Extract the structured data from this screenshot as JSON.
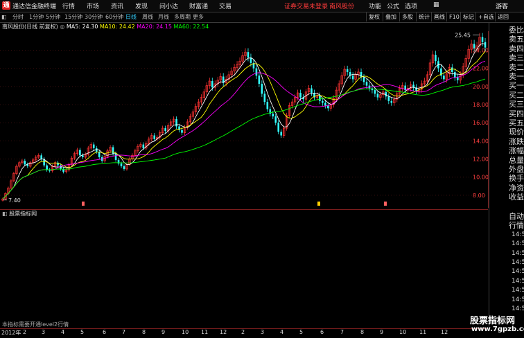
{
  "app": {
    "title": "通达信金融终端",
    "logo_char": "通",
    "user_label": "游客"
  },
  "menu": [
    "行情",
    "市场",
    "资讯",
    "发现",
    "问小达",
    "财富通",
    "交易"
  ],
  "status": {
    "warning": "证券交易未登录",
    "stock_name": "南风股份"
  },
  "periods": [
    "分时",
    "1分钟",
    "5分钟",
    "15分钟",
    "30分钟",
    "60分钟",
    "日线",
    "周线",
    "月线",
    "多周期",
    "更多"
  ],
  "active_period": "日线",
  "toolbar_buttons": [
    "复权",
    "叠加",
    "多股",
    "统计",
    "画线",
    "F10",
    "标记",
    "+自选",
    "返回"
  ],
  "indicator": {
    "stock_label": "南风股份(日线 前复权)",
    "ma5": "MA5: 24.30",
    "ma10": "MA10: 24.42",
    "ma20": "MA20: 24.15",
    "ma60": "MA60: 22.54"
  },
  "price_axis": [
    "24.00",
    "22.00",
    "20.00",
    "18.00",
    "16.00",
    "14.00",
    "12.00",
    "10.00",
    "8.00"
  ],
  "annotations": {
    "high": "25.45",
    "low": "7.40"
  },
  "right_panel": [
    "委比",
    "卖五",
    "卖四",
    "卖三",
    "卖二",
    "卖一",
    "买一",
    "买二",
    "买三",
    "买四",
    "买五",
    "现价",
    "涨跌",
    "涨幅",
    "总量",
    "外盘",
    "换手",
    "净资",
    "收益",
    "自动",
    "行情",
    "14:5",
    "14:5",
    "14:5",
    "14:5",
    "14:5",
    "14:5",
    "14:5",
    "14:5",
    "14:5"
  ],
  "sub_chart": {
    "title": "股票指标网",
    "message": "本指标需要开通level2行情"
  },
  "time_axis": [
    "2012年",
    "2",
    "3",
    "4",
    "5",
    "6",
    "7",
    "8",
    "9",
    "10",
    "11",
    "12",
    "2",
    "3",
    "4",
    "5",
    "6",
    "7",
    "8",
    "9",
    "10",
    "11",
    "12"
  ],
  "watermark": {
    "line1": "股票指标网",
    "line2": "www.7gpzb.com"
  },
  "colors": {
    "ma5": "#ffffff",
    "ma10": "#ffff00",
    "ma20": "#ff00ff",
    "ma60": "#00ff00",
    "up": "#ff3333",
    "down": "#33ffff",
    "accent": "#35d1ff"
  },
  "chart_data": {
    "type": "candlestick",
    "y_range": [
      7,
      25.8
    ],
    "closes": [
      7.6,
      8.2,
      8.8,
      9.6,
      10.4,
      11.2,
      11.6,
      11.8,
      11.4,
      11.2,
      11.6,
      11.9,
      12.2,
      12.4,
      12.0,
      11.3,
      10.8,
      10.7,
      11.2,
      11.6,
      11.3,
      10.9,
      10.6,
      10.8,
      11.4,
      12.1,
      12.6,
      13.0,
      12.4,
      12.2,
      12.5,
      13.2,
      13.6,
      13.2,
      12.8,
      12.2,
      11.8,
      12.3,
      12.9,
      13.3,
      12.6,
      11.9,
      11.5,
      11.2,
      10.9,
      11.4,
      12.0,
      12.4,
      12.9,
      13.4,
      13.6,
      13.2,
      13.7,
      14.2,
      14.6,
      14.2,
      14.4,
      14.9,
      15.4,
      15.1,
      15.7,
      16.1,
      16.4,
      15.6,
      15.2,
      14.9,
      15.5,
      16.1,
      16.7,
      17.2,
      17.8,
      18.3,
      18.8,
      19.4,
      20.1,
      20.6,
      19.9,
      20.3,
      20.7,
      21.1,
      20.4,
      20.8,
      21.3,
      21.7,
      22.1,
      22.4,
      22.8,
      23.4,
      23.8,
      23.2,
      22.6,
      22.0,
      21.2,
      20.3,
      19.2,
      18.3,
      17.5,
      17.0,
      16.7,
      16.0,
      15.0,
      14.6,
      15.4,
      16.8,
      17.9,
      18.3,
      18.8,
      19.3,
      18.8,
      18.6,
      19.4,
      19.8,
      19.3,
      18.8,
      19.0,
      18.4,
      18.2,
      17.9,
      17.6,
      18.0,
      18.7,
      19.6,
      20.3,
      21.2,
      21.9,
      21.6,
      21.2,
      20.8,
      21.3,
      21.6,
      21.0,
      20.5,
      20.1,
      19.8,
      19.6,
      19.2,
      18.8,
      19.1,
      19.4,
      18.9,
      18.4,
      18.2,
      18.6,
      19.2,
      19.8,
      20.1,
      19.6,
      19.8,
      20.2,
      19.9,
      19.5,
      19.7,
      20.3,
      20.6,
      21.3,
      22.6,
      23.5,
      22.8,
      22.0,
      21.2,
      20.8,
      21.4,
      22.1,
      21.6,
      21.0,
      20.7,
      21.3,
      22.2,
      23.1,
      24.1,
      24.7,
      24.2,
      24.5,
      25.45,
      24.9,
      24.3
    ]
  }
}
